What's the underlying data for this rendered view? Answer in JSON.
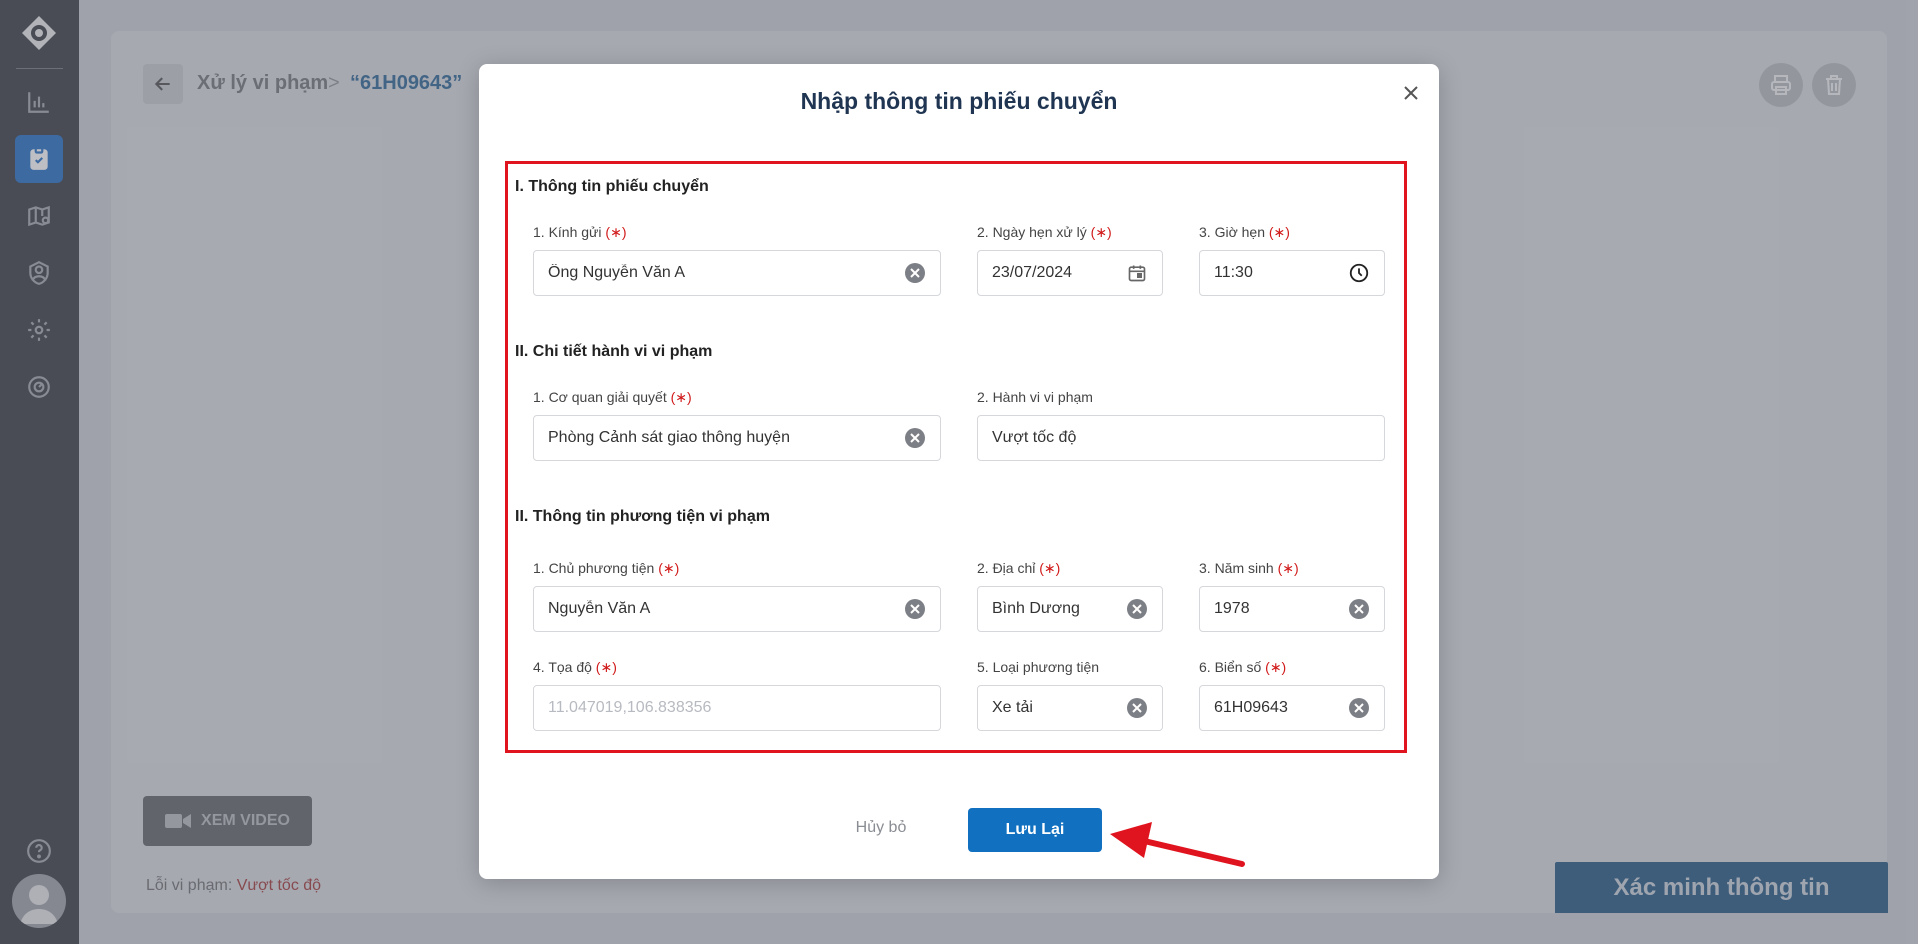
{
  "breadcrumb": {
    "parent": "Xử lý vi phạm",
    "separator": ">",
    "current": "“61H09643”"
  },
  "video_button": {
    "label": "XEM VIDEO"
  },
  "error": {
    "label": "Lỗi vi phạm:",
    "value": "Vượt tốc độ"
  },
  "verify_button": {
    "label": "Xác minh thông tin"
  },
  "modal": {
    "title": "Nhập thông tin phiếu chuyển",
    "required_mark": "(∗)",
    "section1": {
      "title": "I. Thông tin phiếu chuyển",
      "recipient": {
        "label": "1. Kính gửi",
        "value": "Ông Nguyễn Văn A"
      },
      "deadline_date": {
        "label": "2. Ngày hẹn xử lý",
        "value": "23/07/2024"
      },
      "deadline_time": {
        "label": "3. Giờ hẹn",
        "value": "11:30"
      }
    },
    "section2": {
      "title": "II. Chi tiết hành vi vi phạm",
      "agency": {
        "label": "1. Cơ quan giải quyết",
        "value": "Phòng Cảnh sát giao thông huyện"
      },
      "violation": {
        "label": "2. Hành vi vi phạm",
        "value": "Vượt tốc độ"
      }
    },
    "section3": {
      "title": "II. Thông tin phương tiện vi phạm",
      "owner": {
        "label": "1. Chủ phương tiện",
        "value": "Nguyễn Văn A"
      },
      "address": {
        "label": "2. Địa chỉ",
        "value": "Bình Dương"
      },
      "birth_year": {
        "label": "3. Năm sinh",
        "value": "1978"
      },
      "coordinates": {
        "label": "4. Tọa độ",
        "value": "11.047019,106.838356"
      },
      "vehicle_type": {
        "label": "5. Loại phương tiện",
        "value": "Xe tải"
      },
      "plate": {
        "label": "6. Biển số",
        "value": "61H09643"
      }
    },
    "cancel_label": "Hủy bỏ",
    "save_label": "Lưu Lại"
  },
  "colors": {
    "primary": "#1170c0",
    "highlight": "#e0141e",
    "sidebar": "#2b2e35",
    "title": "#1f3552"
  }
}
